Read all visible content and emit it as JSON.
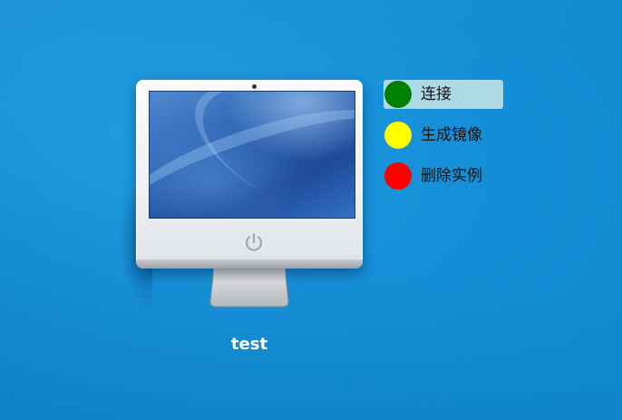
{
  "computer": {
    "name": "test",
    "icon": "imac-computer-icon"
  },
  "actions": [
    {
      "label": "连接",
      "color": "#008000",
      "active": true
    },
    {
      "label": "生成镜像",
      "color": "#ffff00",
      "active": false
    },
    {
      "label": "删除实例",
      "color": "#ff0000",
      "active": false
    }
  ]
}
